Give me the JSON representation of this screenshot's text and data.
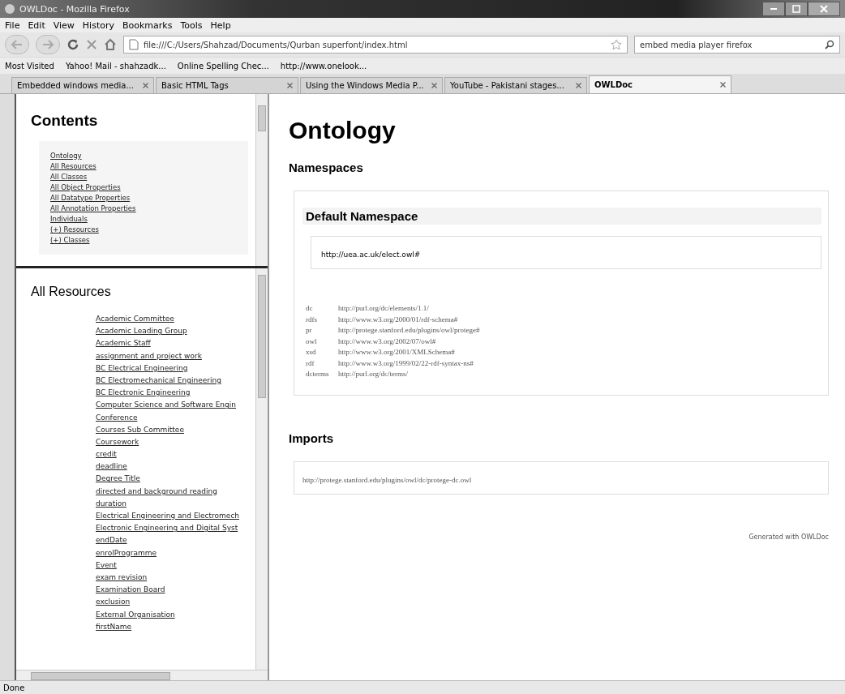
{
  "window": {
    "title": "OWLDoc - Mozilla Firefox"
  },
  "menu": [
    "File",
    "Edit",
    "View",
    "History",
    "Bookmarks",
    "Tools",
    "Help"
  ],
  "address": {
    "value": "file:///C:/Users/Shahzad/Documents/Qurban superfont/index.html"
  },
  "search": {
    "value": "embed media player firefox"
  },
  "bookmarks": [
    "Most Visited",
    "Yahoo! Mail - shahzadk...",
    "Online Spelling Chec...",
    "http://www.onelook..."
  ],
  "tabs": [
    {
      "label": "Embedded windows media...",
      "selected": false
    },
    {
      "label": "Basic HTML Tags",
      "selected": false
    },
    {
      "label": "Using the Windows Media P...",
      "selected": false
    },
    {
      "label": "YouTube - Pakistani stages...",
      "selected": false
    },
    {
      "label": "OWLDoc",
      "selected": true
    }
  ],
  "contents": {
    "title": "Contents",
    "links": [
      "Ontology",
      "All Resources",
      "All Classes",
      "All Object Properties",
      "All Datatype Properties",
      "All Annotation Properties",
      "Individuals",
      "(+) Resources",
      "(+) Classes"
    ]
  },
  "resources": {
    "title": "All Resources",
    "links": [
      "Academic Committee",
      "Academic Leading Group",
      "Academic Staff",
      "assignment and project work",
      "BC Electrical Engineering",
      "BC Electromechanical Engineering",
      "BC Electronic Engineering",
      "Computer Science and Software Engin",
      "Conference",
      "Courses Sub Committee",
      "Coursework",
      "credit",
      "deadline",
      "Degree Title",
      "directed and background reading",
      "duration",
      "Electrical Engineering and Electromech",
      "Electronic Engineering and Digital Syst",
      "endDate",
      "enrolProgramme",
      "Event",
      "exam revision",
      "Examination Board",
      "exclusion",
      "External Organisation",
      "firstName"
    ]
  },
  "main": {
    "title": "Ontology",
    "namespaces_heading": "Namespaces",
    "default_heading": "Default Namespace",
    "default_namespace": "http://uea.ac.uk/elect.owl#",
    "prefixes": [
      {
        "prefix": "dc",
        "uri": "http://purl.org/dc/elements/1.1/"
      },
      {
        "prefix": "rdfs",
        "uri": "http://www.w3.org/2000/01/rdf-schema#"
      },
      {
        "prefix": "pr",
        "uri": "http://protege.stanford.edu/plugins/owl/protege#"
      },
      {
        "prefix": "owl",
        "uri": "http://www.w3.org/2002/07/owl#"
      },
      {
        "prefix": "xsd",
        "uri": "http://www.w3.org/2001/XMLSchema#"
      },
      {
        "prefix": "rdf",
        "uri": "http://www.w3.org/1999/02/22-rdf-syntax-ns#"
      },
      {
        "prefix": "dcterms",
        "uri": "http://purl.org/dc/terms/"
      }
    ],
    "imports_heading": "Imports",
    "imports": [
      "http://protege.stanford.edu/plugins/owl/dc/protege-dc.owl"
    ],
    "footer": "Generated with OWLDoc"
  },
  "status_bar": "Done"
}
